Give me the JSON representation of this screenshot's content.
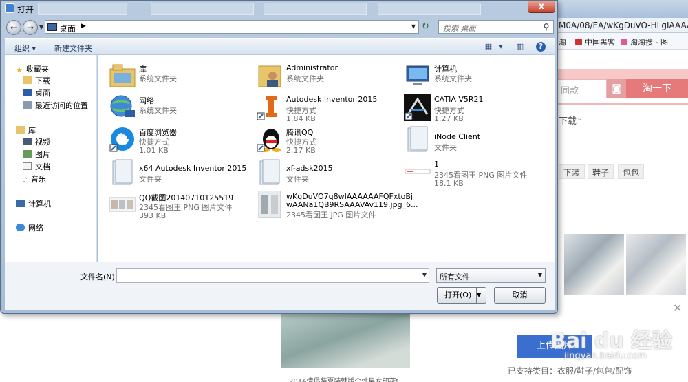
{
  "browser": {
    "url_fragment": "M0A/08/EA/wKgDuVO-HLgIAAAAA",
    "favorites": [
      "淘",
      "中国黑客",
      "淘淘搜 - 图"
    ],
    "search_placeholder": "同款",
    "search_button": "淘一下",
    "download_label": "下载",
    "tags": [
      "下装",
      "鞋子",
      "包包"
    ],
    "upload_button": "上传图片",
    "support_text": "已支持类目：衣服/鞋子/包包/配饰",
    "caption": "2014情侣装夏装韩版个性男女印花t",
    "watermark": "Bai du 经验",
    "watermark_sub": "jingyan.baidu.com"
  },
  "dialog": {
    "title": "打开",
    "close_label": "x",
    "address": {
      "location": "桌面"
    },
    "search_placeholder": "搜索 桌面",
    "toolbar": {
      "organize": "组织 ▾",
      "new_folder": "新建文件夹"
    },
    "nav": {
      "favorites": "收藏夹",
      "download": "下载",
      "desktop": "桌面",
      "recent": "最近访问的位置",
      "libraries": "库",
      "videos": "视频",
      "pictures": "图片",
      "documents": "文档",
      "music": "音乐",
      "computer": "计算机",
      "network": "网络"
    },
    "files": [
      {
        "name": "库",
        "type": "系统文件夹",
        "size": "",
        "icon": "library-icon"
      },
      {
        "name": "Administrator",
        "type": "系统文件夹",
        "size": "",
        "icon": "user-folder-icon"
      },
      {
        "name": "计算机",
        "type": "系统文件夹",
        "size": "",
        "icon": "computer-icon"
      },
      {
        "name": "网络",
        "type": "系统文件夹",
        "size": "",
        "icon": "network-icon"
      },
      {
        "name": "Autodesk Inventor 2015",
        "type": "快捷方式",
        "size": "1.84 KB",
        "icon": "inventor-icon"
      },
      {
        "name": "CATIA V5R21",
        "type": "快捷方式",
        "size": "1.27 KB",
        "icon": "catia-icon"
      },
      {
        "name": "百度浏览器",
        "type": "快捷方式",
        "size": "1.01 KB",
        "icon": "baidu-browser-icon"
      },
      {
        "name": "腾讯QQ",
        "type": "快捷方式",
        "size": "2.17 KB",
        "icon": "qq-icon"
      },
      {
        "name": "iNode Client",
        "type": "文件夹",
        "size": "",
        "icon": "folder-icon"
      },
      {
        "name": "x64 Autodesk Inventor 2015",
        "type": "文件夹",
        "size": "",
        "icon": "folder-icon"
      },
      {
        "name": "xf-adsk2015",
        "type": "文件夹",
        "size": "",
        "icon": "folder-icon"
      },
      {
        "name": "1",
        "type": "2345看图王 PNG 图片文件",
        "size": "18.1 KB",
        "icon": "png-thumb-icon"
      },
      {
        "name": "QQ截图20140710125519",
        "type": "2345看图王 PNG 图片文件",
        "size": "393 KB",
        "icon": "png-thumb-icon"
      },
      {
        "name": "wKgDuVO7q8wIAAAAAAFQFxtoBj",
        "name2": "wAANa1QB9RSAAAVAv119.jpg_6...",
        "type": "2345看图王 JPG 图片文件",
        "size": "",
        "icon": "jpg-thumb-icon"
      }
    ],
    "filename_label": "文件名(N):",
    "filename_value": "",
    "filetype": "所有文件",
    "open_button": "打开(O)",
    "cancel_button": "取消"
  },
  "colors": {
    "accent": "#3d7fd1",
    "pink": "#e67a7a",
    "upload": "#3a6fd0"
  }
}
